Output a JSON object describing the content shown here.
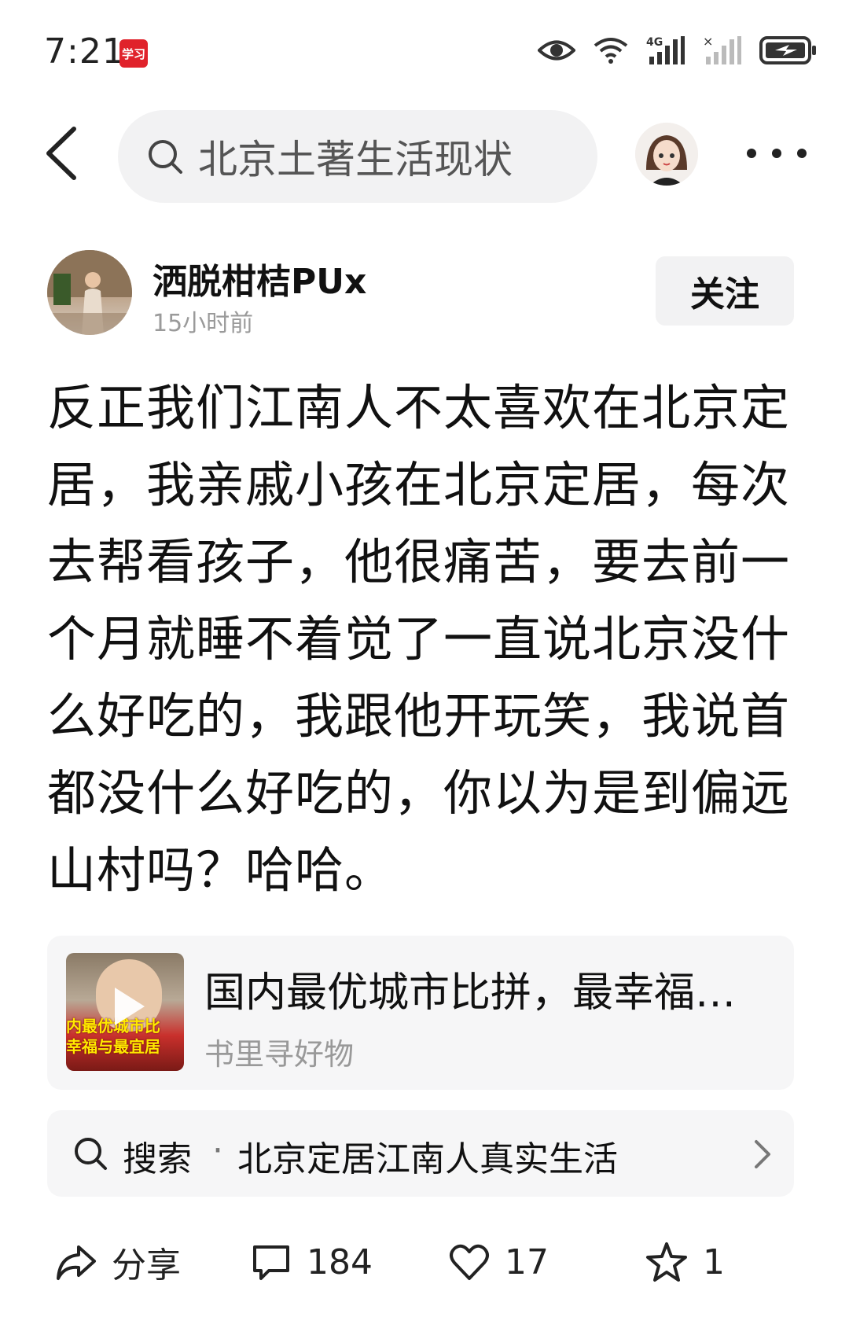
{
  "status_bar": {
    "time": "7:21",
    "app_badge": "学习",
    "icons": [
      "eye-icon",
      "wifi-icon",
      "signal-4g-icon",
      "signal-no-service-icon",
      "battery-charging-icon"
    ],
    "network_label": "4G"
  },
  "nav": {
    "search_text": "北京土著生活现状"
  },
  "author": {
    "name": "洒脱柑桔PUx",
    "time": "15小时前",
    "follow_label": "关注"
  },
  "post": {
    "text": "反正我们江南人不太喜欢在北京定居，我亲戚小孩在北京定居，每次去帮看孩子，他很痛苦，要去前一个月就睡不着觉了一直说北京没什么好吃的，我跟他开玩笑，我说首都没什么好吃的，你以为是到偏远山村吗？哈哈。"
  },
  "video_card": {
    "title": "国内最优城市比拼，最幸福…",
    "source": "书里寻好物",
    "thumb_caption_line1": "内最优城市比",
    "thumb_caption_line2": "幸福与最宜居"
  },
  "search_suggest": {
    "label": "搜索",
    "dot": "·",
    "query": "北京定居江南人真实生活"
  },
  "actions": {
    "share_label": "分享",
    "comment_count": "184",
    "like_count": "17",
    "favorite_count": "1"
  },
  "colors": {
    "background": "#ffffff",
    "card_bg": "#f6f6f7",
    "search_bg": "#f2f2f3",
    "muted_text": "#9a9a9a",
    "badge_red": "#e0222b"
  }
}
